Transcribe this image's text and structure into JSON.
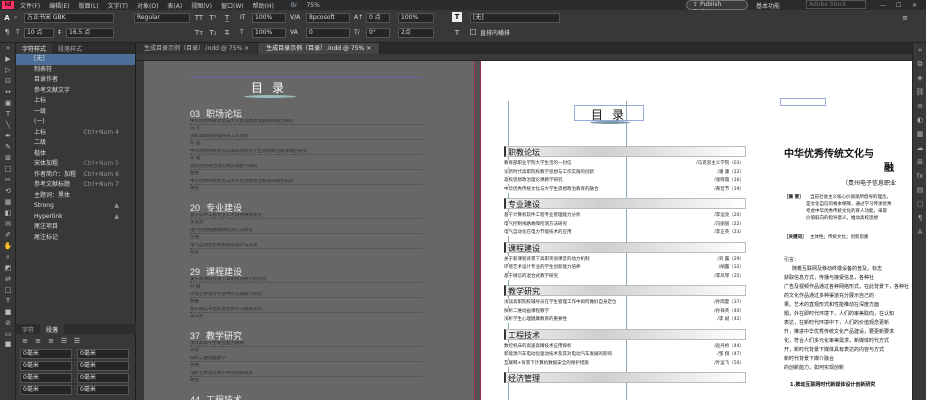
{
  "app": {
    "logo": "Id"
  },
  "menu": [
    "文件(F)",
    "编辑(E)",
    "版面(L)",
    "文字(T)",
    "对象(O)",
    "表(A)",
    "视图(V)",
    "窗口(W)",
    "帮助(H)"
  ],
  "menu_right": {
    "bridge": "Br",
    "zoom": "75%",
    "publish": "Publish Online",
    "workspace": "基本功能",
    "search_placeholder": "Adobe Stock"
  },
  "control": {
    "font_family": "方正书宋 GBK",
    "font_style": "Regular",
    "font_size": "10 点",
    "leading": "16.5 点",
    "scale_h": "100%",
    "scale_v": "100%",
    "tracking": "0",
    "kerning": "度量标准 - 仅罗马字",
    "baseline": "0 点",
    "skew": "0°",
    "char_style": "[无]",
    "char_style_label": "[无]",
    "direction_label": "直排内横排",
    "lang": "8pcosoft",
    "size_small": "2点",
    "percent_right": "100%"
  },
  "styles_panel": {
    "tabs": [
      "字符样式",
      "段落样式"
    ],
    "items": [
      {
        "label": "[无]",
        "shortcut": "",
        "selected": true
      },
      {
        "label": "制表符",
        "shortcut": ""
      },
      {
        "label": "目录作者",
        "shortcut": ""
      },
      {
        "label": "参考文献文字",
        "shortcut": ""
      },
      {
        "label": "上标",
        "shortcut": ""
      },
      {
        "label": "一级",
        "shortcut": ""
      },
      {
        "label": "(一)",
        "shortcut": ""
      },
      {
        "label": "上标",
        "shortcut": "Ctrl+Num 4"
      },
      {
        "label": "二级",
        "shortcut": ""
      },
      {
        "label": "楷体",
        "shortcut": ""
      },
      {
        "label": "宋体加粗",
        "shortcut": "Ctrl+Num 5",
        "dim": true
      },
      {
        "label": "作者简介：加粗",
        "shortcut": "Ctrl+Num 6"
      },
      {
        "label": "参考文献标题",
        "shortcut": "Ctrl+Num 7"
      },
      {
        "label": "主题词：黑体",
        "shortcut": ""
      },
      {
        "label": "Strong",
        "shortcut": "▲"
      },
      {
        "label": "Hyperlink",
        "shortcut": "▲"
      },
      {
        "label": "尾注项目",
        "shortcut": ""
      },
      {
        "label": "尾注标记",
        "shortcut": ""
      }
    ],
    "lower_tabs": [
      "字符",
      "段落"
    ],
    "lower_fields": [
      "0毫米",
      "0毫米",
      "0毫米",
      "0毫米",
      "0毫米",
      "0毫米",
      "0毫米",
      "0毫米",
      "0毫米",
      "0毫米",
      "0毫米"
    ]
  },
  "doc_tabs": [
    "生成目录示例（目录）.indd @ 75%",
    "生成目录示例（目录）.indd @ 75%"
  ],
  "left_page": {
    "title": "目  录",
    "sections": [
      {
        "num": "03",
        "name": "职场论坛",
        "entries": [
          {
            "t": "中华优秀传统文化与大学生思想政治教育的融合研究",
            "a": "白  芳"
          },
          {
            "t": "浅析高职院校辅导员工作创新",
            "a": "邓  晶"
          },
          {
            "t": "中华优秀传统文化与高职院校大学生思想政治教育融合研究",
            "a": "邓  鑫"
          },
          {
            "t": "高校思想政治理论课实践教学研究",
            "a": "易敏"
          },
          {
            "t": "中华优秀传统文化与大学生思想政治教育的融合研究",
            "a": "黄智"
          }
        ]
      },
      {
        "num": "20",
        "name": "专业建设",
        "entries": [
          {
            "t": "基于软件工程专业人才培养模式研究",
            "a": "李远亮"
          },
          {
            "t": "电气控制线路故障检测方法研究",
            "a": "冯丽"
          },
          {
            "t": "电气自动化控制系统的设计与实现",
            "a": "陈思"
          }
        ]
      },
      {
        "num": "29",
        "name": "课程建设",
        "entries": [
          {
            "t": "关于新课程背景下高职英语教学的思考",
            "a": "刘 露"
          },
          {
            "t": "环境艺术设计专业中的实践教学研究",
            "a": "胡露"
          },
          {
            "t": "基于微信平台的混合式学习模式研究",
            "a": "李向文"
          }
        ]
      },
      {
        "num": "37",
        "name": "教学研究",
        "entries": [
          {
            "t": "浅谈高职学生职业能力培养",
            "a": "孙雨"
          },
          {
            "t": "探析二维动画教学",
            "a": "孙祥"
          },
          {
            "t": "浅析艺术设计教学中的创新研究",
            "a": "胡恒"
          }
        ]
      },
      {
        "num": "44",
        "name": "工程技术",
        "entries": []
      }
    ]
  },
  "right_page": {
    "title": "目  录",
    "sections": [
      {
        "name": "职教论坛",
        "entries": [
          {
            "t": "教育部职业学院大学生活的一封信",
            "a": "/马克思主义学院（03）"
          },
          {
            "t": "论新时代高职院校教学思想与工作实践的创新",
            "a": "/潘  康（12）"
          },
          {
            "t": "高校思想政治理论课教学研究",
            "a": "/张晓霞（16）"
          },
          {
            "t": "中华优秀传统文化与大学生思想政治教育的融合",
            "a": "/黄哲节（19）"
          }
        ]
      },
      {
        "name": "专业建设",
        "entries": [
          {
            "t": "基于计算机软件工程专业管理能力分析",
            "a": "/李远亮（20）"
          },
          {
            "t": "电气控制线路故障检测方法研究",
            "a": "/冯丽丽（22）"
          },
          {
            "t": "电气自动化在电力节能技术的应用",
            "a": "/李正英（23）"
          }
        ]
      },
      {
        "name": "课程建设",
        "entries": [
          {
            "t": "关于新课程背景下高职英语课堂的动力机制",
            "a": "/刘  露（29）"
          },
          {
            "t": "环境艺术设计专业的学生创新能力培养",
            "a": "/胡露（32）"
          },
          {
            "t": "基于微信的混合式教学研究",
            "a": "/李凤琴（35）"
          }
        ]
      },
      {
        "name": "教学研究",
        "entries": [
          {
            "t": "浅谈高职院校辅导员在学生管理工作中如何做好自身定位",
            "a": "/孙雨夏（37）"
          },
          {
            "t": "探析二维动画课程教学",
            "a": "/孙祥英（40）"
          },
          {
            "t": "浅析学生心理健康教育的重要性",
            "a": "/李  斌（42）"
          }
        ]
      },
      {
        "name": "工程技术",
        "entries": [
          {
            "t": "数控机床的高速高精技术应用探析",
            "a": "/赵丹桥（44）"
          },
          {
            "t": "新能源汽车电动化驱动技术及其对电动汽车发展的影响",
            "a": "/邹  翔（47）"
          },
          {
            "t": "互联网+背景下计算机数据安全的保护措施",
            "a": "/叶运飞（50）"
          }
        ]
      },
      {
        "name": "经济管理",
        "entries": []
      }
    ]
  },
  "third_page": {
    "heading": "中华优秀传统文化与",
    "heading2": "融",
    "school": "（贵州电子信息职业",
    "abstract_label": "［摘  要］",
    "abstract_lines": [
      "当前社会主义核心价值观所倡导的理念，",
      "是文化自信的根本保障，通过学习传承优秀",
      "考虑中华优秀传统文化的育人功能，采取",
      "价值取向的指导意义，推动高校思想"
    ],
    "keywords_label": "［关键词］",
    "keywords": "主体性；传统文化；创新思路",
    "intro": "引言：",
    "body_lines": [
      "随着互联网及移动终端设备的普及，标志",
      "获取信息方式，传播与接受信息，各种社",
      "广告及视频作品通过各种网络形式，在此背景下，各种社",
      "的文化作品通过多种渠道充分展示自己的",
      "果。艺术的直观形式和性能推动在深度方面",
      "题，外在即时代环境下，人们的审美取向，在认知",
      "表达，在新时代环境中下，人们的价值观念更新",
      "升，推进中华优秀传统文化产品建设，要更新要求",
      "化，符合人们多元化审美需求，新媒体时代方式",
      "开，新时代背景下媒体具有表达的内容与方式",
      "新时代背景下媒介融合",
      "的创新能力，如何实现创新"
    ],
    "subhead": "1.推动互联网时代新媒体设计创新研究"
  }
}
